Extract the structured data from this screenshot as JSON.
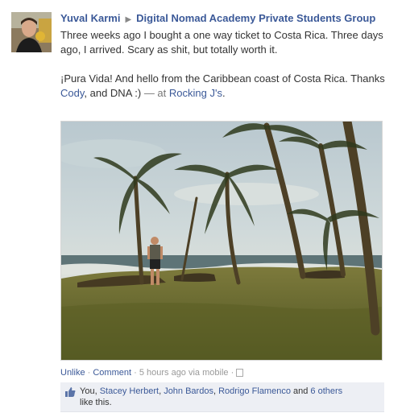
{
  "post": {
    "author": "Yuval Karmi",
    "target_group": "Digital Nomad Academy Private Students Group",
    "paragraph1": "Three weeks ago I bought a one way ticket to Costa Rica. Three days ago, I arrived. Scary as shit, but totally worth it.",
    "p2_part1": "¡Pura Vida! And hello from the Caribbean coast of Costa Rica. Thanks ",
    "tag_cody": "Cody",
    "p2_part2": ", and DNA :)",
    "at_prefix": " — at ",
    "location": "Rocking J's",
    "location_suffix": "."
  },
  "footer": {
    "unlike": "Unlike",
    "comment": "Comment",
    "separator": " · ",
    "time": "5 hours ago via mobile",
    "mobile_icon": "mobile-icon"
  },
  "likes": {
    "prefix": "You, ",
    "people": [
      "Stacey Herbert",
      "John Bardos",
      "Rodrigo Flamenco"
    ],
    "comma": ", ",
    "and": " and ",
    "others": "6 others",
    "suffix": " like this.",
    "icon": "thumbs-up-icon"
  },
  "colors": {
    "link": "#3b5998",
    "likes_background": "#edeff4"
  }
}
